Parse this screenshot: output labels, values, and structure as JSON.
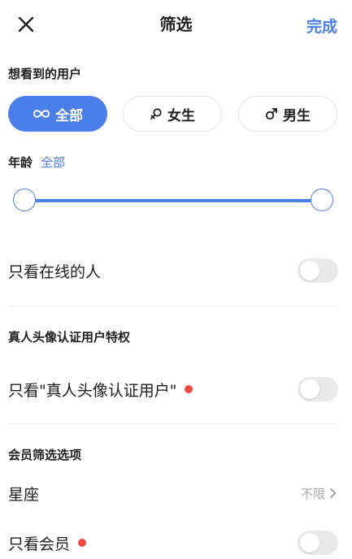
{
  "colors": {
    "accent": "#4a7ee8",
    "track": "#4a7ee8",
    "toggle_off": "#e9e9e9",
    "red_dot": "#f04a3e"
  },
  "header": {
    "title": "筛选",
    "done_label": "完成",
    "close_icon": "close-icon"
  },
  "gender_section": {
    "title": "想看到的用户",
    "options": [
      {
        "label": "全部",
        "icon": "infinity-icon",
        "selected": true
      },
      {
        "label": "女生",
        "icon": "female-icon",
        "selected": false
      },
      {
        "label": "男生",
        "icon": "male-icon",
        "selected": false
      }
    ]
  },
  "age": {
    "label": "年龄",
    "value": "全部"
  },
  "online": {
    "label": "只看在线的人",
    "enabled": false
  },
  "verified_section": {
    "title": "真人头像认证用户特权",
    "label": "只看\"真人头像认证用户\"",
    "enabled": false
  },
  "member_section": {
    "title": "会员筛选选项",
    "constellation_label": "星座",
    "constellation_value": "不限",
    "member_only_label": "只看会员",
    "member_only_enabled": false
  }
}
